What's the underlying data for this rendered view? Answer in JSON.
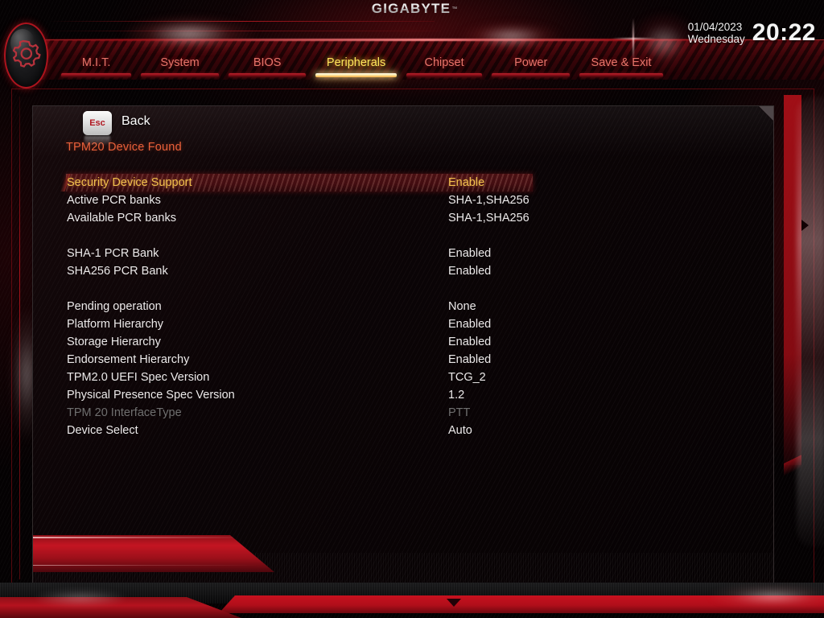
{
  "brand": {
    "logo": "GIGABYTE",
    "tm": "™"
  },
  "clock": {
    "date": "01/04/2023",
    "weekday": "Wednesday",
    "time": "20:22"
  },
  "nav": {
    "tabs": [
      {
        "label": "M.I.T.",
        "active": false
      },
      {
        "label": "System",
        "active": false
      },
      {
        "label": "BIOS",
        "active": false
      },
      {
        "label": "Peripherals",
        "active": true
      },
      {
        "label": "Chipset",
        "active": false
      },
      {
        "label": "Power",
        "active": false
      },
      {
        "label": "Save & Exit",
        "active": false
      }
    ]
  },
  "panel": {
    "section_title": "TPM20 Device Found",
    "rows": [
      {
        "key": "Security Device Support",
        "value": "Enable",
        "state": "selected"
      },
      {
        "key": "Active PCR banks",
        "value": "SHA-1,SHA256",
        "state": "normal"
      },
      {
        "key": "Available PCR banks",
        "value": "SHA-1,SHA256",
        "state": "normal"
      },
      {
        "key": "",
        "value": "",
        "state": "spacer"
      },
      {
        "key": "SHA-1 PCR Bank",
        "value": "Enabled",
        "state": "normal"
      },
      {
        "key": "SHA256 PCR Bank",
        "value": "Enabled",
        "state": "normal"
      },
      {
        "key": "",
        "value": "",
        "state": "spacer"
      },
      {
        "key": "Pending operation",
        "value": "None",
        "state": "normal"
      },
      {
        "key": "Platform Hierarchy",
        "value": "Enabled",
        "state": "normal"
      },
      {
        "key": "Storage Hierarchy",
        "value": "Enabled",
        "state": "normal"
      },
      {
        "key": "Endorsement Hierarchy",
        "value": "Enabled",
        "state": "normal"
      },
      {
        "key": "TPM2.0 UEFI Spec Version",
        "value": "TCG_2",
        "state": "normal"
      },
      {
        "key": "Physical Presence Spec Version",
        "value": "1.2",
        "state": "normal"
      },
      {
        "key": "TPM 20 InterfaceType",
        "value": "PTT",
        "state": "disabled"
      },
      {
        "key": "Device Select",
        "value": "Auto",
        "state": "normal"
      }
    ]
  },
  "footer": {
    "esc_key": "Esc",
    "back_label": "Back"
  },
  "icons": {
    "gear": "gear-icon",
    "scroll_right": "scroll-right-arrow-icon",
    "scroll_down": "scroll-down-arrow-icon"
  },
  "colors": {
    "accent_red": "#c4151f",
    "active_tab_yellow": "#ffe85c",
    "inactive_tab": "#e8746a",
    "section_title": "#e8603a",
    "value_text": "#eceaea",
    "disabled_text": "#6f6f6f",
    "selected_text": "#f3c14e",
    "selected_bg": "#430d11"
  }
}
